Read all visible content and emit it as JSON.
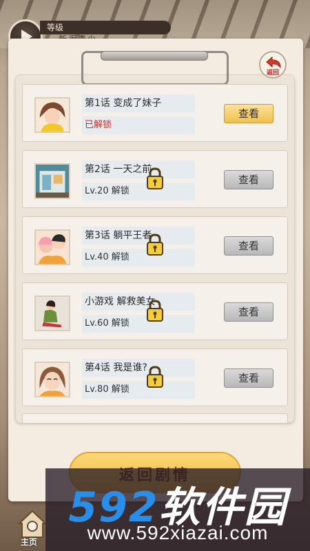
{
  "hud": {
    "level_label": "等级",
    "subtitle": "新手青少"
  },
  "back": {
    "label": "返回",
    "icon": "back-arrow-icon"
  },
  "episodes": [
    {
      "title": "第1话 变成了妹子",
      "status": "已解锁",
      "unlocked": true,
      "button": "查看"
    },
    {
      "title": "第2话 一天之前",
      "status": "Lv.20 解锁",
      "unlocked": false,
      "button": "查看"
    },
    {
      "title": "第3话 躺平王者",
      "status": "Lv.40 解锁",
      "unlocked": false,
      "button": "查看"
    },
    {
      "title": "小游戏 解救美女",
      "status": "Lv.60 解锁",
      "unlocked": false,
      "button": "查看"
    },
    {
      "title": "第4话 我是谁?",
      "status": "Lv.80 解锁",
      "unlocked": false,
      "button": "查看"
    }
  ],
  "bottom": {
    "home_label": "主页",
    "action_button": "返回剧情"
  },
  "watermark": {
    "brand_num": "592",
    "brand_text": "软件园",
    "url": "www.592xiazai.com"
  },
  "colors": {
    "unlocked_status": "#e0261c",
    "active_button": "#f0c14f",
    "locked_button": "#b8b8b8",
    "watermark_blue": "#2a8de8"
  }
}
